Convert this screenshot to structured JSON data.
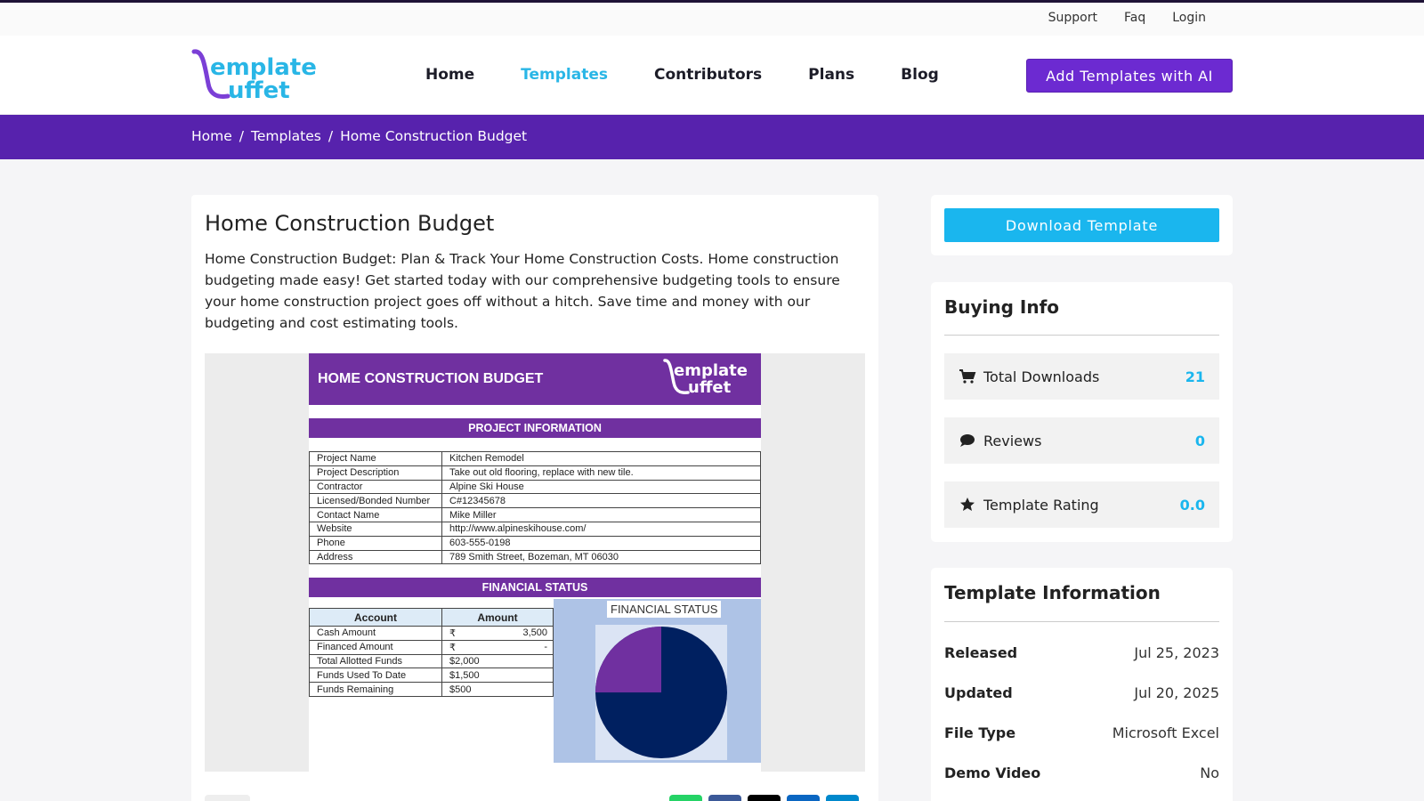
{
  "topbar": {
    "links": [
      "Support",
      "Faq",
      "Login"
    ]
  },
  "nav": {
    "items": [
      {
        "label": "Home",
        "active": false
      },
      {
        "label": "Templates",
        "active": true
      },
      {
        "label": "Contributors",
        "active": false
      },
      {
        "label": "Plans",
        "active": false
      },
      {
        "label": "Blog",
        "active": false
      }
    ],
    "ai_button": "Add Templates with AI"
  },
  "breadcrumb": {
    "items": [
      "Home",
      "Templates",
      "Home Construction Budget"
    ],
    "separator": "/"
  },
  "template": {
    "title": "Home Construction Budget",
    "description": "Home Construction Budget: Plan & Track Your Home Construction Costs. Home construction budgeting made easy! Get started today with our comprehensive budgeting tools to ensure your home construction project goes off without a hitch. Save time and money with our budgeting and cost estimating tools."
  },
  "preview": {
    "header_title": "HOME CONSTRUCTION BUDGET",
    "project_band": "PROJECT INFORMATION",
    "project_rows": [
      [
        "Project Name",
        "Kitchen Remodel"
      ],
      [
        "Project Description",
        "Take out old flooring, replace with new tile."
      ],
      [
        "Contractor",
        "Alpine Ski House"
      ],
      [
        "Licensed/Bonded Number",
        "C#12345678"
      ],
      [
        "Contact Name",
        "Mike Miller"
      ],
      [
        "Website",
        "http://www.alpineskihouse.com/"
      ],
      [
        "Phone",
        "603-555-0198"
      ],
      [
        "Address",
        "789 Smith Street, Bozeman, MT 06030"
      ]
    ],
    "financial_band": "FINANCIAL STATUS",
    "account_header": [
      "Account",
      "Amount"
    ],
    "account_rows": [
      [
        "Cash Amount",
        "₹",
        "3,500"
      ],
      [
        "Financed Amount",
        "₹",
        "-"
      ],
      [
        "Total Allotted Funds",
        "$2,000",
        ""
      ],
      [
        "Funds Used To Date",
        "$1,500",
        ""
      ],
      [
        "Funds Remaining",
        "$500",
        ""
      ]
    ],
    "chart_title": "FINANCIAL STATUS",
    "pie_colors": [
      "#002060",
      "#7030a0"
    ],
    "pie_slice_fraction": 0.25
  },
  "sidebar": {
    "download_button": "Download Template",
    "buying_info": {
      "heading": "Buying Info",
      "stats": [
        {
          "icon": "cart-icon",
          "label": "Total Downloads",
          "value": "21"
        },
        {
          "icon": "comment-icon",
          "label": "Reviews",
          "value": "0"
        },
        {
          "icon": "star-icon",
          "label": "Template Rating",
          "value": "0.0"
        }
      ]
    },
    "template_info": {
      "heading": "Template Information",
      "rows": [
        {
          "key": "Released",
          "value": "Jul 25, 2023"
        },
        {
          "key": "Updated",
          "value": "Jul 20, 2025"
        },
        {
          "key": "File Type",
          "value": "Microsoft Excel"
        },
        {
          "key": "Demo Video",
          "value": "No"
        }
      ]
    }
  },
  "colors": {
    "accent": "#6c2ad1",
    "breadcrumb_bg": "#5722ad",
    "link_active": "#29b6e6",
    "download": "#1ab6ee"
  }
}
